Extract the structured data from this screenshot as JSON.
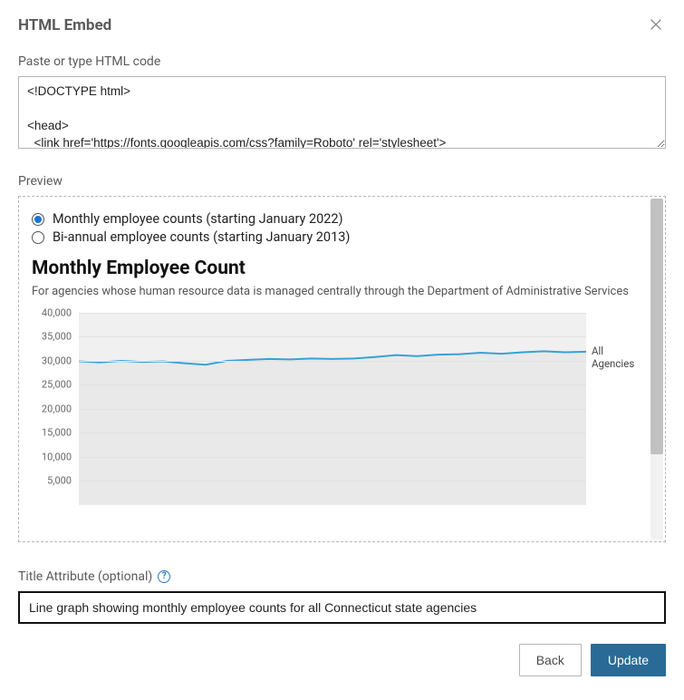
{
  "dialog": {
    "title": "HTML Embed",
    "code_label": "Paste or type HTML code",
    "code_value": "<!DOCTYPE html>\n\n<head>\n  <link href='https://fonts.googleapis.com/css?family=Roboto' rel='stylesheet'>",
    "preview_label": "Preview",
    "title_attr_label": "Title Attribute (optional)",
    "title_attr_value": "Line graph showing monthly employee counts for all Connecticut state agencies",
    "back_label": "Back",
    "update_label": "Update"
  },
  "preview": {
    "radio1_label": "Monthly employee counts (starting January 2022)",
    "radio2_label": "Bi-annual employee counts (starting January 2013)",
    "chart_title": "Monthly Employee Count",
    "chart_desc": "For agencies whose human resource data is managed centrally through the Department of Administrative Services",
    "legend": "All Agencies"
  },
  "chart_data": {
    "type": "line",
    "title": "Monthly Employee Count",
    "xlabel": "",
    "ylabel": "",
    "ylim": [
      0,
      40000
    ],
    "yticks": [
      5000,
      10000,
      15000,
      20000,
      25000,
      30000,
      35000,
      40000
    ],
    "ytick_labels": [
      "5,000",
      "10,000",
      "15,000",
      "20,000",
      "25,000",
      "30,000",
      "35,000",
      "40,000"
    ],
    "series": [
      {
        "name": "All Agencies",
        "values": [
          29900,
          29700,
          30000,
          29800,
          29900,
          29500,
          29200,
          30000,
          30200,
          30400,
          30300,
          30500,
          30400,
          30500,
          30800,
          31200,
          31000,
          31300,
          31400,
          31700,
          31500,
          31800,
          32000,
          31800,
          31900
        ]
      }
    ]
  }
}
